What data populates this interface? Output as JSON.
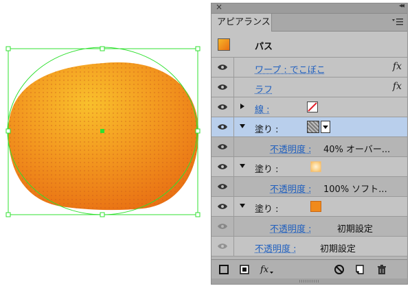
{
  "panel": {
    "tab_title": "アピアランス",
    "close_glyph": "×",
    "collapse_glyph": "◂◂",
    "menu_icon": "panel-menu-icon",
    "accent_selected": "#b9cfec",
    "link_color": "#1f5fbf"
  },
  "rows": {
    "path_label": "パス",
    "warp_label": "ワープ : でこぼこ",
    "warp_fx": "fx",
    "roughen_label": "ラフ",
    "roughen_fx": "fx",
    "stroke_label": "線 :",
    "fill1_label": "塗り :",
    "fill1_opacity_label": "不透明度 :",
    "fill1_opacity_value": "40% オーバー...",
    "fill2_label": "塗り :",
    "fill2_opacity_label": "不透明度 :",
    "fill2_opacity_value": "100% ソフト...",
    "fill3_label": "塗り :",
    "fill3_opacity_label": "不透明度 :",
    "fill3_opacity_value": "初期設定",
    "object_opacity_label": "不透明度 :",
    "object_opacity_value": "初期設定"
  },
  "artwork": {
    "fill_color": "#f08a1c",
    "highlight_color": "#f7b629",
    "selection_color": "#2fe02f"
  }
}
